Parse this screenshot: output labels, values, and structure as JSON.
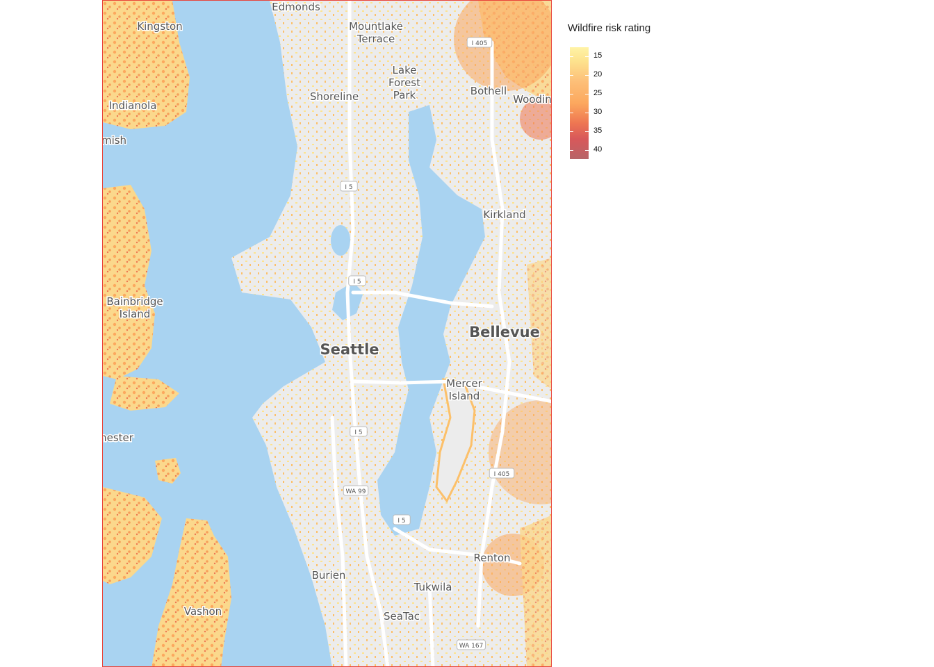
{
  "map": {
    "places": [
      {
        "id": "edmonds",
        "label": "Edmonds"
      },
      {
        "id": "kingston",
        "label": "Kingston"
      },
      {
        "id": "mountlake",
        "label": "Mountlake"
      },
      {
        "id": "terrace",
        "label": "Terrace"
      },
      {
        "id": "lake",
        "label": "Lake"
      },
      {
        "id": "forest",
        "label": "Forest"
      },
      {
        "id": "park",
        "label": "Park"
      },
      {
        "id": "shoreline",
        "label": "Shoreline"
      },
      {
        "id": "bothell",
        "label": "Bothell"
      },
      {
        "id": "woodin",
        "label": "Woodin"
      },
      {
        "id": "indianola",
        "label": "Indianola"
      },
      {
        "id": "mish",
        "label": "mish"
      },
      {
        "id": "kirkland",
        "label": "Kirkland"
      },
      {
        "id": "bainbridge",
        "label": "Bainbridge"
      },
      {
        "id": "island1",
        "label": "Island"
      },
      {
        "id": "bellevue",
        "label": "Bellevue"
      },
      {
        "id": "seattle",
        "label": "Seattle"
      },
      {
        "id": "mercer",
        "label": "Mercer"
      },
      {
        "id": "island2",
        "label": "Island"
      },
      {
        "id": "nester",
        "label": "nester"
      },
      {
        "id": "renton",
        "label": "Renton"
      },
      {
        "id": "burien",
        "label": "Burien"
      },
      {
        "id": "tukwila",
        "label": "Tukwila"
      },
      {
        "id": "vashon",
        "label": "Vashon"
      },
      {
        "id": "seatac",
        "label": "SeaTac"
      }
    ],
    "shields": [
      {
        "id": "i405a",
        "label": "I 405"
      },
      {
        "id": "i5a",
        "label": "I 5"
      },
      {
        "id": "i5b",
        "label": "I 5"
      },
      {
        "id": "i5c",
        "label": "I 5"
      },
      {
        "id": "i405b",
        "label": "I 405"
      },
      {
        "id": "wa99",
        "label": "WA 99"
      },
      {
        "id": "i5d",
        "label": "I 5"
      },
      {
        "id": "wa167",
        "label": "WA 167"
      }
    ]
  },
  "legend": {
    "title": "Wildfire risk rating",
    "ticks": [
      "15",
      "20",
      "25",
      "30",
      "35",
      "40"
    ]
  },
  "colors": {
    "water": "#a9d3f1",
    "land": "#ececec",
    "risk_low": "#fde38e",
    "risk_mid": "#fca85e",
    "risk_high": "#d8585a",
    "frame": "#e8433a"
  }
}
